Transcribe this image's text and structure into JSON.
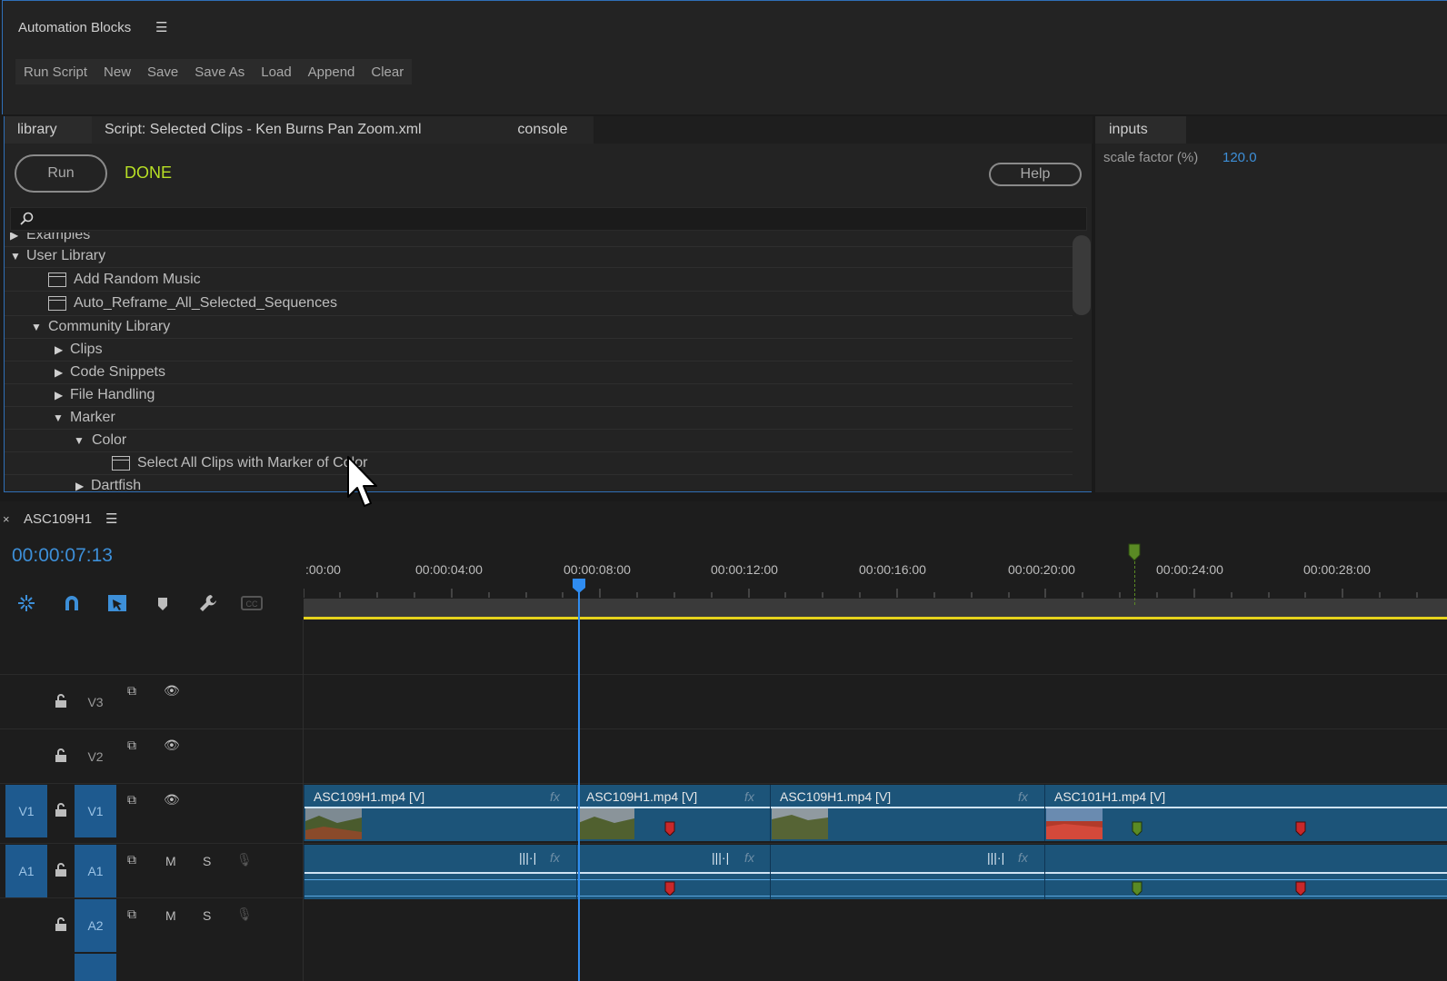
{
  "app": {
    "title": "Automation Blocks"
  },
  "menu": [
    "Run Script",
    "New",
    "Save",
    "Save As",
    "Load",
    "Append",
    "Clear"
  ],
  "library_panel": {
    "tabs": [
      "library",
      "Script: Selected Clips - Ken Burns Pan Zoom.xml",
      "console"
    ],
    "run_label": "Run",
    "status": "DONE",
    "help_label": "Help",
    "search_placeholder": "",
    "tree": [
      {
        "label": "Examples",
        "expanded": false,
        "type": "folder",
        "depth": 0
      },
      {
        "label": "User Library",
        "expanded": true,
        "type": "folder",
        "depth": 0
      },
      {
        "label": "Add Random Music",
        "type": "script",
        "depth": 1
      },
      {
        "label": "Auto_Reframe_All_Selected_Sequences",
        "type": "script",
        "depth": 1
      },
      {
        "label": "Community Library",
        "expanded": true,
        "type": "folder",
        "depth": 1
      },
      {
        "label": "Clips",
        "expanded": false,
        "type": "folder",
        "depth": 2
      },
      {
        "label": "Code Snippets",
        "expanded": false,
        "type": "folder",
        "depth": 2
      },
      {
        "label": "File Handling",
        "expanded": false,
        "type": "folder",
        "depth": 2
      },
      {
        "label": "Marker",
        "expanded": true,
        "type": "folder",
        "depth": 2
      },
      {
        "label": "Color",
        "expanded": true,
        "type": "folder",
        "depth": 3
      },
      {
        "label": "Select All Clips with Marker of Color",
        "type": "script",
        "depth": 4
      },
      {
        "label": "Dartfish",
        "expanded": false,
        "type": "folder",
        "depth": 3
      }
    ]
  },
  "inputs_panel": {
    "tab": "inputs",
    "fields": [
      {
        "label": "scale factor (%)",
        "value": "120.0"
      }
    ]
  },
  "timeline": {
    "sequence_name": "ASC109H1",
    "timecode": "00:00:07:13",
    "ruler_labels": [
      ":00:00",
      "00:00:04:00",
      "00:00:08:00",
      "00:00:12:00",
      "00:00:16:00",
      "00:00:20:00",
      "00:00:24:00",
      "00:00:28:00"
    ],
    "tools": [
      "nest-icon",
      "snap-icon",
      "linked-selection-icon",
      "add-marker-icon",
      "wrench-icon",
      "captions-icon"
    ],
    "tracks": {
      "V3": {
        "name": "V3"
      },
      "V2": {
        "name": "V2"
      },
      "V1": {
        "source": "V1",
        "name": "V1"
      },
      "A1": {
        "source": "A1",
        "name": "A1",
        "m": "M",
        "s": "S"
      },
      "A2": {
        "name": "A2",
        "m": "M",
        "s": "S"
      }
    },
    "video_clips": [
      {
        "name": "ASC109H1.mp4 [V]",
        "fx": "fx"
      },
      {
        "name": "ASC109H1.mp4 [V]",
        "fx": "fx"
      },
      {
        "name": "ASC109H1.mp4 [V]",
        "fx": "fx"
      },
      {
        "name": "ASC101H1.mp4 [V]",
        "fx": ""
      }
    ],
    "audio_fx": "fx",
    "colors": {
      "accent": "#2f8cf0",
      "clip": "#1c5479",
      "track_target": "#1e5a8f",
      "marker_red": "#c8282a",
      "marker_green": "#5a8a24",
      "status_done": "#b8e025",
      "work_area": "#e5d21c"
    }
  }
}
